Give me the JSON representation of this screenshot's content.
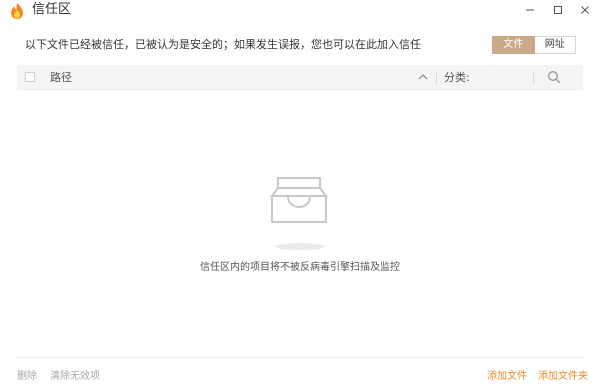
{
  "window": {
    "title": "信任区",
    "controls": {
      "minimize": "minimize-icon",
      "maximize": "maximize-icon",
      "close": "close-icon"
    }
  },
  "info": {
    "text": "以下文件已经被信任，已被认为是安全的；如果发生误报，您也可以在此加入信任"
  },
  "tabs": [
    {
      "label": "文件",
      "active": true
    },
    {
      "label": "网址",
      "active": false
    }
  ],
  "table": {
    "columns": {
      "path": "路径",
      "category": "分类:"
    },
    "rows": []
  },
  "empty_state": {
    "icon": "empty-tray-icon",
    "text": "信任区内的项目将不被反病毒引擎扫描及监控"
  },
  "footer": {
    "delete": "删除",
    "clear_invalid": "清除无效项",
    "add_file": "添加文件",
    "add_folder": "添加文件夹"
  },
  "colors": {
    "accent_tab": "#c9a988",
    "link_orange": "#e88a2e",
    "disabled_text": "#a8a8a8",
    "header_bg": "#f5f5f5"
  }
}
